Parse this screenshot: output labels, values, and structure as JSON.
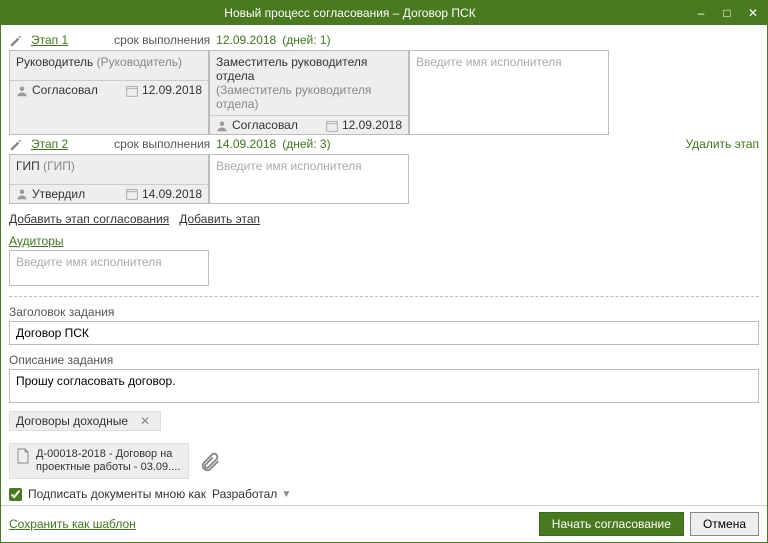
{
  "window": {
    "title": "Новый процесс согласования – Договор ПСК"
  },
  "stages": [
    {
      "label": "Этап 1",
      "due_label": "срок выполнения",
      "due_date": "12.09.2018",
      "days": "(дней: 1)",
      "delete": "",
      "cards": [
        {
          "name": "Руководитель",
          "role": "(Руководитель)",
          "status": "Согласовал",
          "date": "12.09.2018"
        },
        {
          "name": "Заместитель руководителя отдела",
          "role": "(Заместитель руководителя отдела)",
          "status": "Согласовал",
          "date": "12.09.2018"
        }
      ],
      "placeholder": "Введите имя исполнителя"
    },
    {
      "label": "Этап 2",
      "due_label": "срок выполнения",
      "due_date": "14.09.2018",
      "days": "(дней: 3)",
      "delete": "Удалить этап",
      "cards": [
        {
          "name": "ГИП",
          "role": "(ГИП)",
          "status": "Утвердил",
          "date": "14.09.2018"
        }
      ],
      "placeholder": "Введите имя исполнителя"
    }
  ],
  "links": {
    "add_approval_stage": "Добавить этап согласования",
    "add_stage": "Добавить этап"
  },
  "auditors": {
    "label": "Аудиторы",
    "placeholder": "Введите имя исполнителя"
  },
  "task_title": {
    "label": "Заголовок задания",
    "value": "Договор ПСК"
  },
  "task_desc": {
    "label": "Описание задания",
    "value": "Прошу согласовать договор."
  },
  "tag": {
    "text": "Договоры доходные"
  },
  "attachment": {
    "line1": "Д-00018-2018 - Договор на",
    "line2": "проектные работы - 03.09...."
  },
  "sign": {
    "label": "Подписать документы мною как",
    "option": "Разработал"
  },
  "footer": {
    "save_template": "Сохранить как шаблон",
    "start": "Начать согласование",
    "cancel": "Отмена"
  }
}
